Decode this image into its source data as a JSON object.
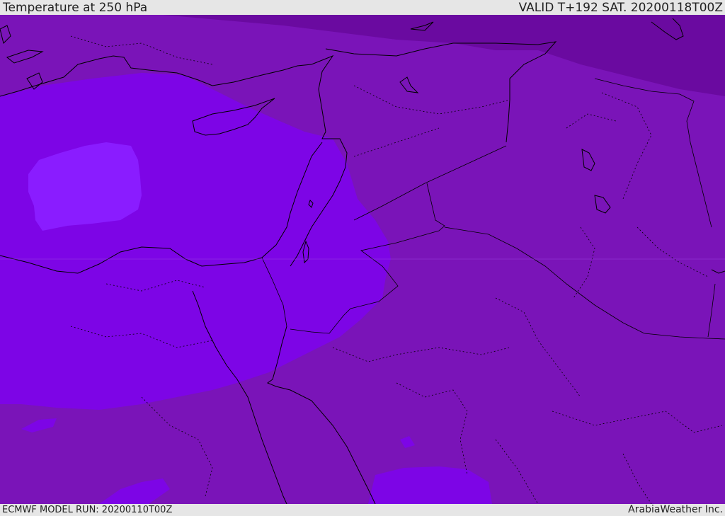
{
  "header": {
    "title": "Temperature at 250 hPa",
    "valid_time": "VALID T+192 SAT. 20200118T00Z"
  },
  "footer": {
    "model_run": "ECMWF MODEL RUN: 20200110T00Z",
    "credit": "ArabiaWeather Inc."
  },
  "map": {
    "field": "temperature",
    "level_hpa": 250,
    "colors": {
      "coldest": "#8a1cff",
      "cold": "#7d05e6",
      "mid": "#7a14b8",
      "warm": "#6a0aa0",
      "outline": "#000000"
    }
  }
}
